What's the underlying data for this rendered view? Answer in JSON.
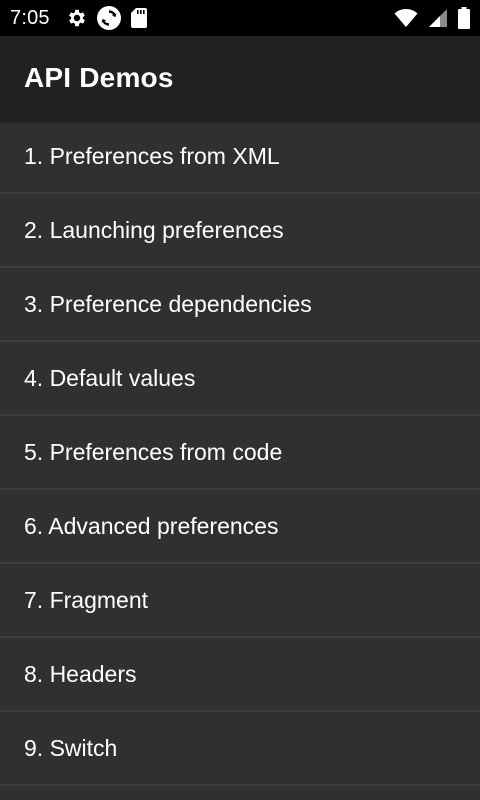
{
  "status_bar": {
    "time": "7:05",
    "left_icons": [
      "gear-icon",
      "sync-icon",
      "sd-card-icon"
    ],
    "right_icons": [
      "wifi-icon",
      "cell-signal-icon",
      "battery-icon"
    ]
  },
  "app_bar": {
    "title": "API Demos"
  },
  "list": {
    "items": [
      {
        "label": "1. Preferences from XML"
      },
      {
        "label": "2. Launching preferences"
      },
      {
        "label": "3. Preference dependencies"
      },
      {
        "label": "4. Default values"
      },
      {
        "label": "5. Preferences from code"
      },
      {
        "label": "6. Advanced preferences"
      },
      {
        "label": "7. Fragment"
      },
      {
        "label": "8. Headers"
      },
      {
        "label": "9. Switch"
      }
    ]
  },
  "colors": {
    "status_bar_bg": "#000000",
    "app_bar_bg": "#212121",
    "list_bg": "#303030",
    "divider": "#3e3e3e",
    "text": "#ffffff"
  }
}
